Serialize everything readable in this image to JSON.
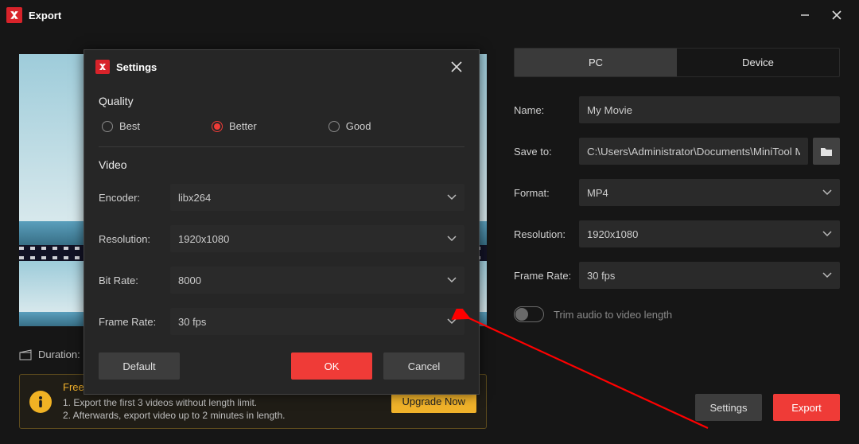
{
  "titlebar": {
    "title": "Export"
  },
  "preview": {
    "duration_label": "Duration:"
  },
  "right": {
    "tabs": {
      "pc": "PC",
      "device": "Device"
    },
    "name_label": "Name:",
    "name_value": "My Movie",
    "saveto_label": "Save to:",
    "saveto_value": "C:\\Users\\Administrator\\Documents\\MiniTool Movie",
    "format_label": "Format:",
    "format_value": "MP4",
    "resolution_label": "Resolution:",
    "resolution_value": "1920x1080",
    "framerate_label": "Frame Rate:",
    "framerate_value": "30 fps",
    "trim_label": "Trim audio to video length",
    "settings_btn": "Settings",
    "export_btn": "Export"
  },
  "limits": {
    "heading": "Free Edition Limitations:",
    "line1": "1. Export the first 3 videos without length limit.",
    "line2": "2. Afterwards, export video up to 2 minutes in length.",
    "upgrade": "Upgrade Now"
  },
  "modal": {
    "title": "Settings",
    "quality_title": "Quality",
    "q_best": "Best",
    "q_better": "Better",
    "q_good": "Good",
    "video_title": "Video",
    "encoder_label": "Encoder:",
    "encoder_value": "libx264",
    "resolution_label": "Resolution:",
    "resolution_value": "1920x1080",
    "bitrate_label": "Bit Rate:",
    "bitrate_value": "8000",
    "framerate_label": "Frame Rate:",
    "framerate_value": "30 fps",
    "default_btn": "Default",
    "ok_btn": "OK",
    "cancel_btn": "Cancel"
  }
}
